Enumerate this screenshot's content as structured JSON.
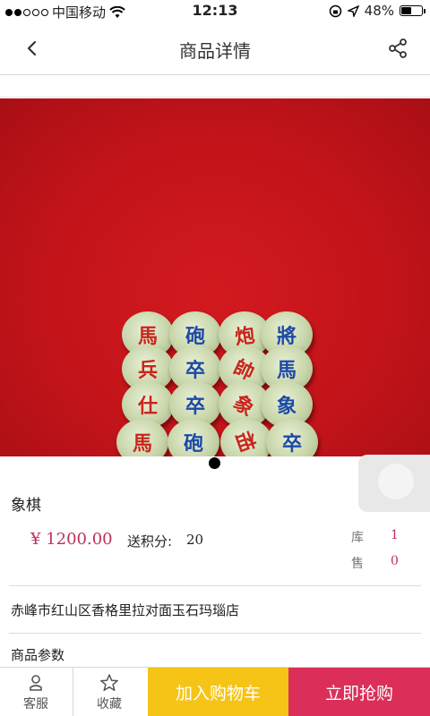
{
  "status_bar": {
    "carrier": "中国移动",
    "time": "12:13",
    "battery": "48%",
    "battery_level": 0.48,
    "signal_dots_filled": 2,
    "signal_dots_total": 5
  },
  "nav": {
    "title": "商品详情",
    "back_icon": "chevron-left-icon",
    "share_icon": "share-icon"
  },
  "product": {
    "name": "象棋",
    "price": "¥ 1200.00",
    "points_label": "送积分:",
    "points_value": "20",
    "stock_label": "库",
    "stock_value": "1",
    "sold_label": "售",
    "sold_value": "0",
    "shop_address": "赤峰市红山区香格里拉对面玉石玛瑙店",
    "params_label": "商品参数"
  },
  "image": {
    "pieces": [
      {
        "char": "馬",
        "color": "red"
      },
      {
        "char": "砲",
        "color": "blue"
      },
      {
        "char": "炮",
        "color": "red"
      },
      {
        "char": "將",
        "color": "blue"
      },
      {
        "char": "兵",
        "color": "red"
      },
      {
        "char": "卒",
        "color": "blue"
      },
      {
        "char": "帥",
        "color": "red"
      },
      {
        "char": "馬",
        "color": "blue"
      },
      {
        "char": "仕",
        "color": "red"
      },
      {
        "char": "卒",
        "color": "blue"
      },
      {
        "char": "象",
        "color": "red"
      },
      {
        "char": "象",
        "color": "blue"
      },
      {
        "char": "馬",
        "color": "red"
      },
      {
        "char": "砲",
        "color": "blue"
      },
      {
        "char": "相",
        "color": "red"
      },
      {
        "char": "卒",
        "color": "blue"
      }
    ],
    "piece_rotations": [
      0,
      0,
      -8,
      0,
      0,
      0,
      25,
      0,
      0,
      0,
      35,
      0,
      0,
      0,
      160,
      0
    ]
  },
  "bottom_bar": {
    "service_label": "客服",
    "service_icon": "user-icon",
    "favorite_label": "收藏",
    "favorite_icon": "star-icon",
    "cart_label": "加入购物车",
    "buy_label": "立即抢购"
  },
  "colors": {
    "price": "#c0305a",
    "cart_button": "#f6c417",
    "buy_button": "#db2f5a",
    "image_background": "#c3141a"
  }
}
